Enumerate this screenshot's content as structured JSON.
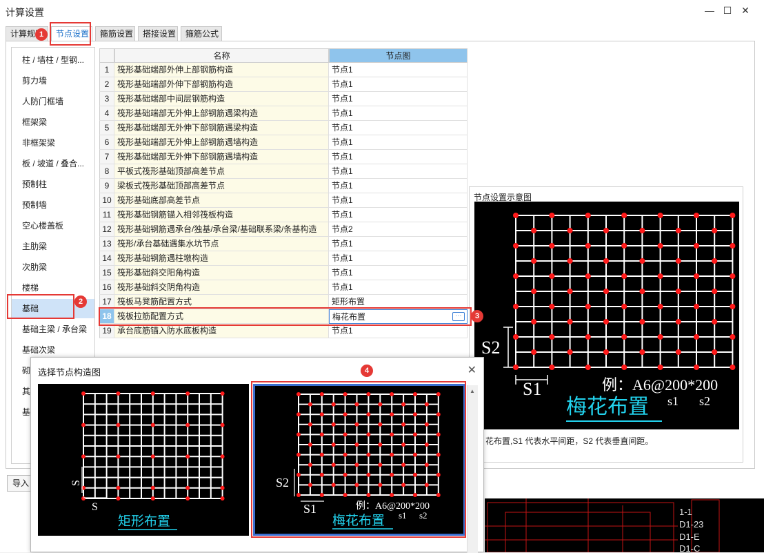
{
  "window": {
    "title": "计算设置",
    "min": "—",
    "max": "☐",
    "close": "✕"
  },
  "tabs": [
    "计算规则",
    "节点设置",
    "箍筋设置",
    "搭接设置",
    "箍筋公式"
  ],
  "sidebar": {
    "items": [
      "柱 / 墙柱 / 型钢...",
      "剪力墙",
      "人防门框墙",
      "框架梁",
      "非框架梁",
      "板 / 坡道 / 叠合...",
      "预制柱",
      "预制墙",
      "空心楼盖板",
      "主肋梁",
      "次肋梁",
      "楼梯",
      "基础",
      "基础主梁 / 承台梁",
      "基础次梁",
      "砌",
      "其",
      "基"
    ]
  },
  "grid": {
    "headers": {
      "name": "名称",
      "node": "节点图"
    },
    "rows": [
      {
        "n": "1",
        "name": "筏形基础端部外伸上部钢筋构造",
        "v": "节点1"
      },
      {
        "n": "2",
        "name": "筏形基础端部外伸下部钢筋构造",
        "v": "节点1"
      },
      {
        "n": "3",
        "name": "筏形基础端部中间层钢筋构造",
        "v": "节点1"
      },
      {
        "n": "4",
        "name": "筏形基础端部无外伸上部钢筋遇梁构造",
        "v": "节点1"
      },
      {
        "n": "5",
        "name": "筏形基础端部无外伸下部钢筋遇梁构造",
        "v": "节点1"
      },
      {
        "n": "6",
        "name": "筏形基础端部无外伸上部钢筋遇墙构造",
        "v": "节点1"
      },
      {
        "n": "7",
        "name": "筏形基础端部无外伸下部钢筋遇墙构造",
        "v": "节点1"
      },
      {
        "n": "8",
        "name": "平板式筏形基础顶部高差节点",
        "v": "节点1"
      },
      {
        "n": "9",
        "name": "梁板式筏形基础顶部高差节点",
        "v": "节点1"
      },
      {
        "n": "10",
        "name": "筏形基础底部高差节点",
        "v": "节点1"
      },
      {
        "n": "11",
        "name": "筏形基础钢筋锚入相邻筏板构造",
        "v": "节点1"
      },
      {
        "n": "12",
        "name": "筏形基础钢筋遇承台/独基/承台梁/基础联系梁/条基构造",
        "v": "节点2"
      },
      {
        "n": "13",
        "name": "筏形/承台基础遇集水坑节点",
        "v": "节点1"
      },
      {
        "n": "14",
        "name": "筏形基础钢筋遇柱墩构造",
        "v": "节点1"
      },
      {
        "n": "15",
        "name": "筏形基础斜交阳角构造",
        "v": "节点1"
      },
      {
        "n": "16",
        "name": "筏形基础斜交阴角构造",
        "v": "节点1"
      },
      {
        "n": "17",
        "name": "筏板马凳筋配置方式",
        "v": "矩形布置"
      },
      {
        "n": "18",
        "name": "筏板拉筋配置方式",
        "v": "梅花布置"
      },
      {
        "n": "19",
        "name": "承台底筋锚入防水底板构造",
        "v": "节点1"
      }
    ],
    "more_btn": "···"
  },
  "preview": {
    "title": "节点设置示意图",
    "label_s1": "S1",
    "label_s2": "S2",
    "example": "例：A6@200*200",
    "sub_s1": "s1",
    "sub_s2": "s2",
    "caption": "梅花布置",
    "desc": "花布置,S1 代表水平间距，S2 代表垂直间距。"
  },
  "import_btn": "导入",
  "badges": [
    "1",
    "2",
    "3",
    "4"
  ],
  "dialog": {
    "title": "选择节点构造图",
    "close": "✕",
    "option1": {
      "caption": "矩形布置",
      "label_s": "S"
    },
    "option2": {
      "caption": "梅花布置",
      "label_s1": "S1",
      "label_s2": "S2",
      "example": "例：A6@200*200",
      "sub_s1": "s1",
      "sub_s2": "s2"
    },
    "scroll_up": "▲"
  },
  "cad": {
    "texts": [
      "1-1",
      "D1-23",
      "D1-E",
      "D1-C"
    ]
  },
  "colors": {
    "accent": "#1a6fc9",
    "highlight": "#8fc4ec",
    "annotation": "#e53935",
    "cad_dot": "#ff1a1a",
    "cad_cyan": "#22d3ee"
  }
}
